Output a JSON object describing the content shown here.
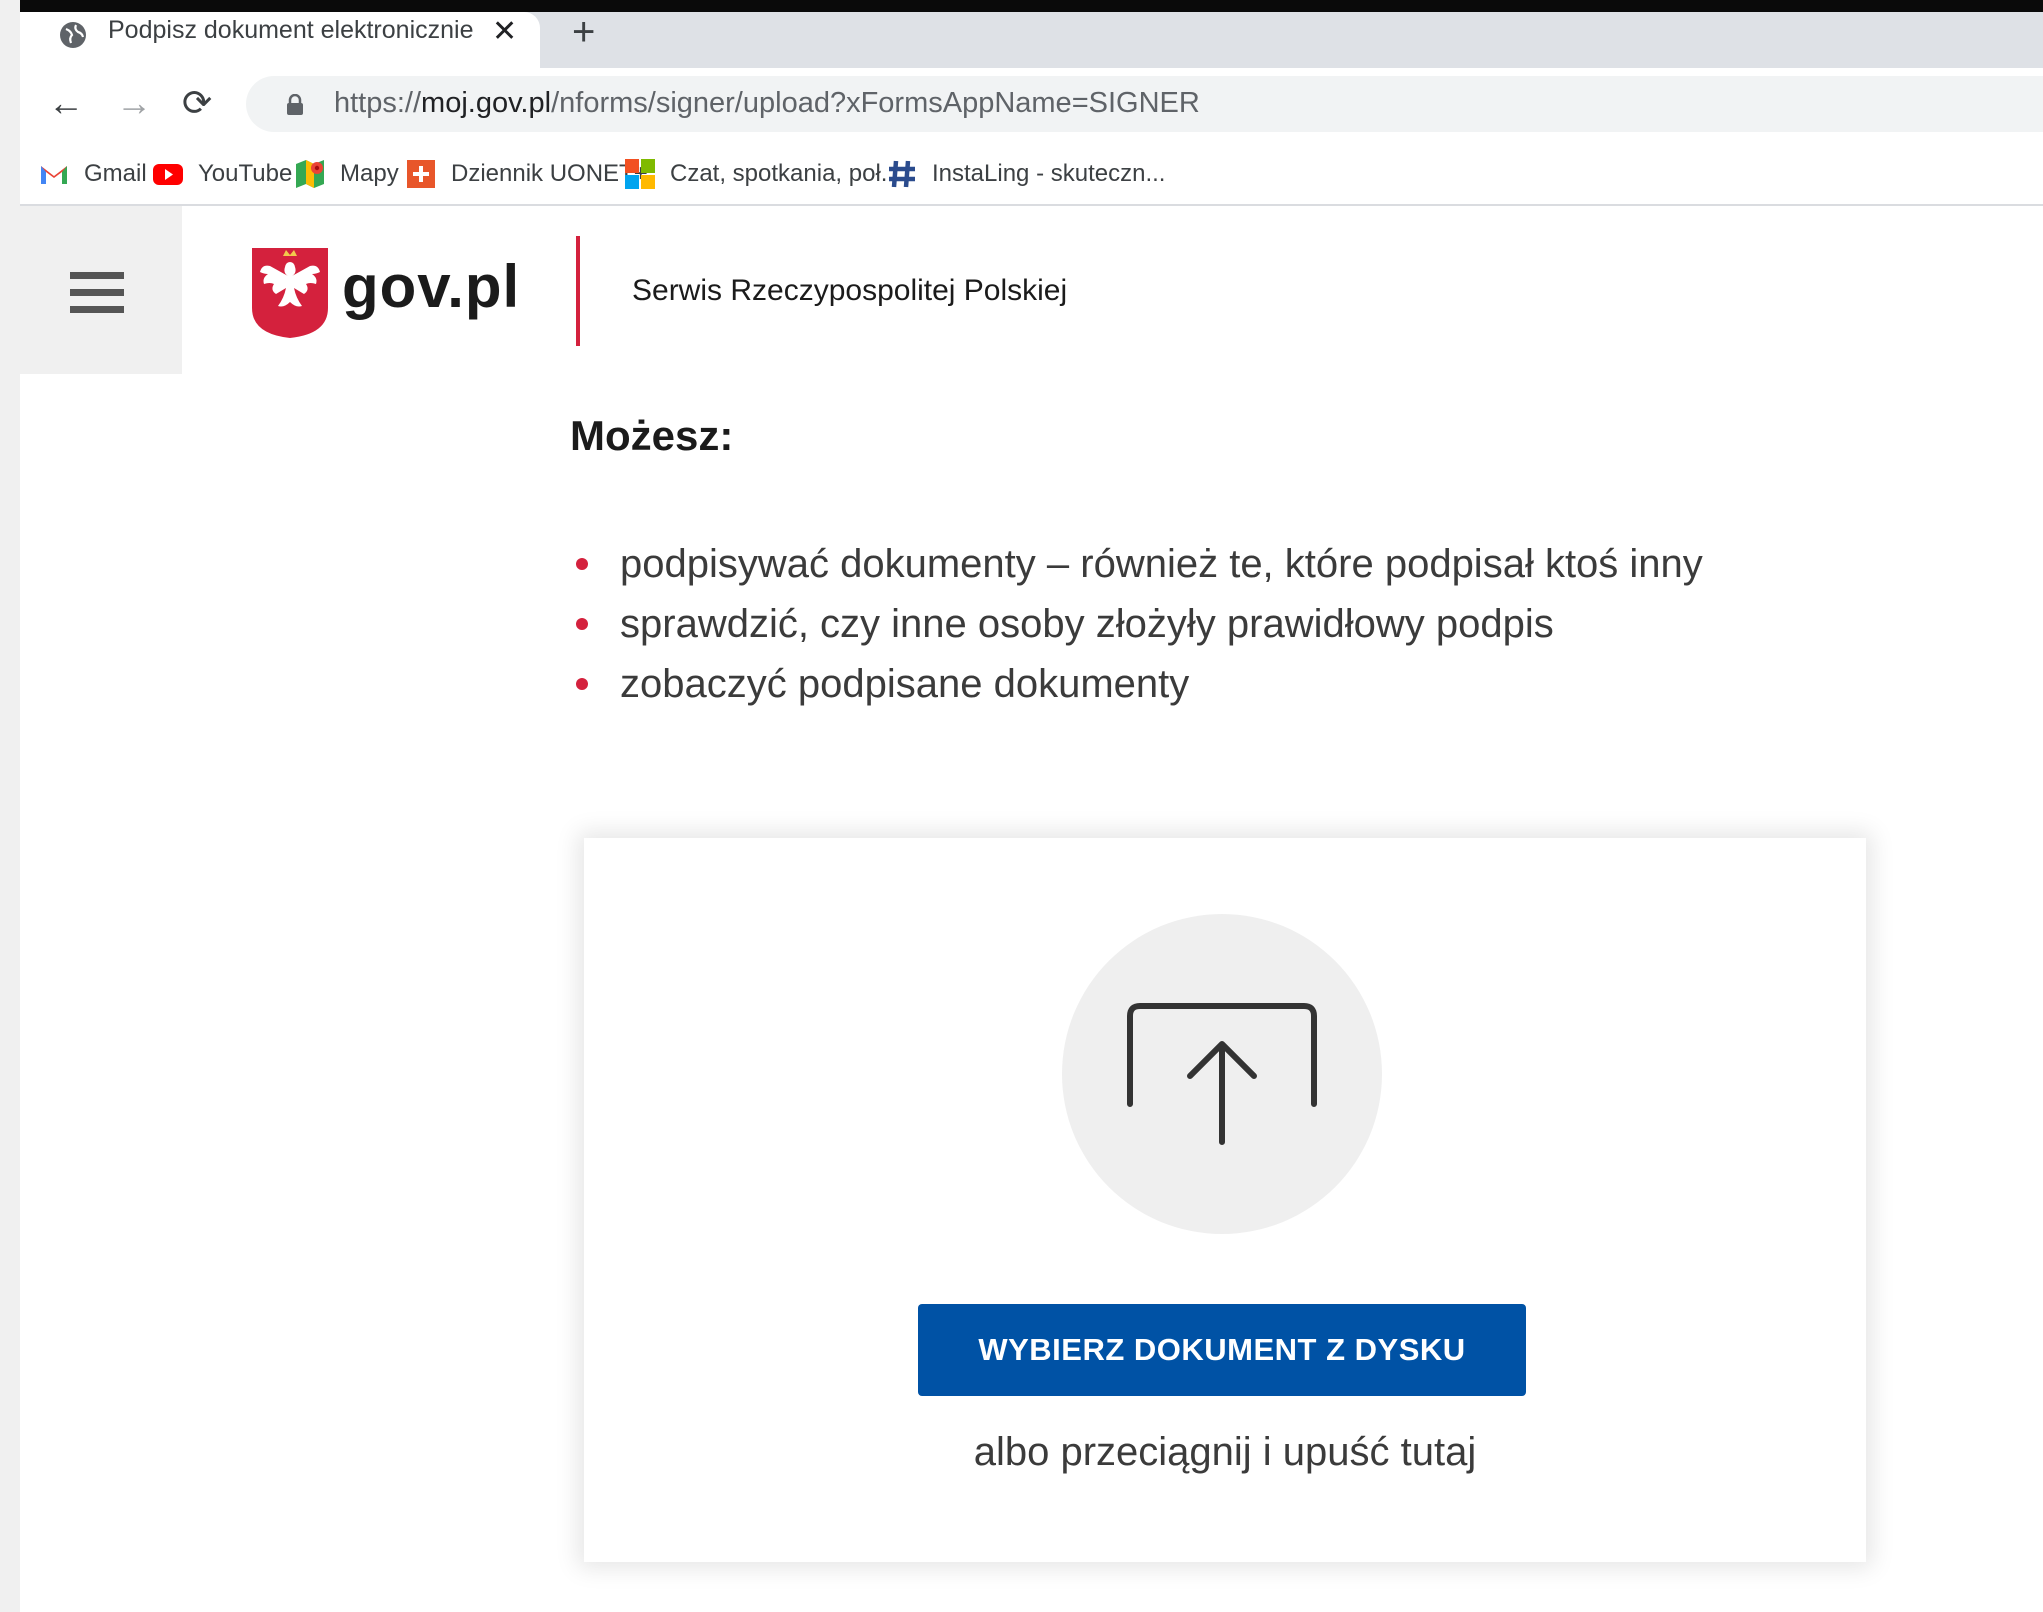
{
  "browser": {
    "tab": {
      "title": "Podpisz dokument elektronicznie",
      "close_label": "✕",
      "new_tab_label": "+"
    },
    "nav": {
      "back": "←",
      "forward": "→",
      "reload": "⟳"
    },
    "address": {
      "scheme": "https://",
      "host": "moj.gov.pl",
      "path": "/nforms/signer/upload?xFormsAppName=SIGNER"
    },
    "bookmarks": [
      {
        "label": "Gmail",
        "icon": "gmail-icon"
      },
      {
        "label": "YouTube",
        "icon": "youtube-icon"
      },
      {
        "label": "Mapy",
        "icon": "maps-icon"
      },
      {
        "label": "Dziennik UONET+",
        "icon": "uonet-icon"
      },
      {
        "label": "Czat, spotkania, poł...",
        "icon": "microsoft-icon"
      },
      {
        "label": "InstaLing - skuteczn...",
        "icon": "instaling-icon"
      }
    ]
  },
  "header": {
    "logo_text": "gov.pl",
    "service_name": "Serwis Rzeczypospolitej Polskiej"
  },
  "main": {
    "heading": "Możesz:",
    "features": [
      "podpisywać dokumenty – również te, które podpisał ktoś inny",
      "sprawdzić, czy inne osoby złożyły prawidłowy podpis",
      "zobaczyć podpisane dokumenty"
    ],
    "upload": {
      "button_label": "WYBIERZ DOKUMENT Z DYSKU",
      "drop_hint": "albo przeciągnij i upuść tutaj"
    }
  },
  "colors": {
    "accent_red": "#d4213d",
    "button_blue": "#0052a5"
  }
}
